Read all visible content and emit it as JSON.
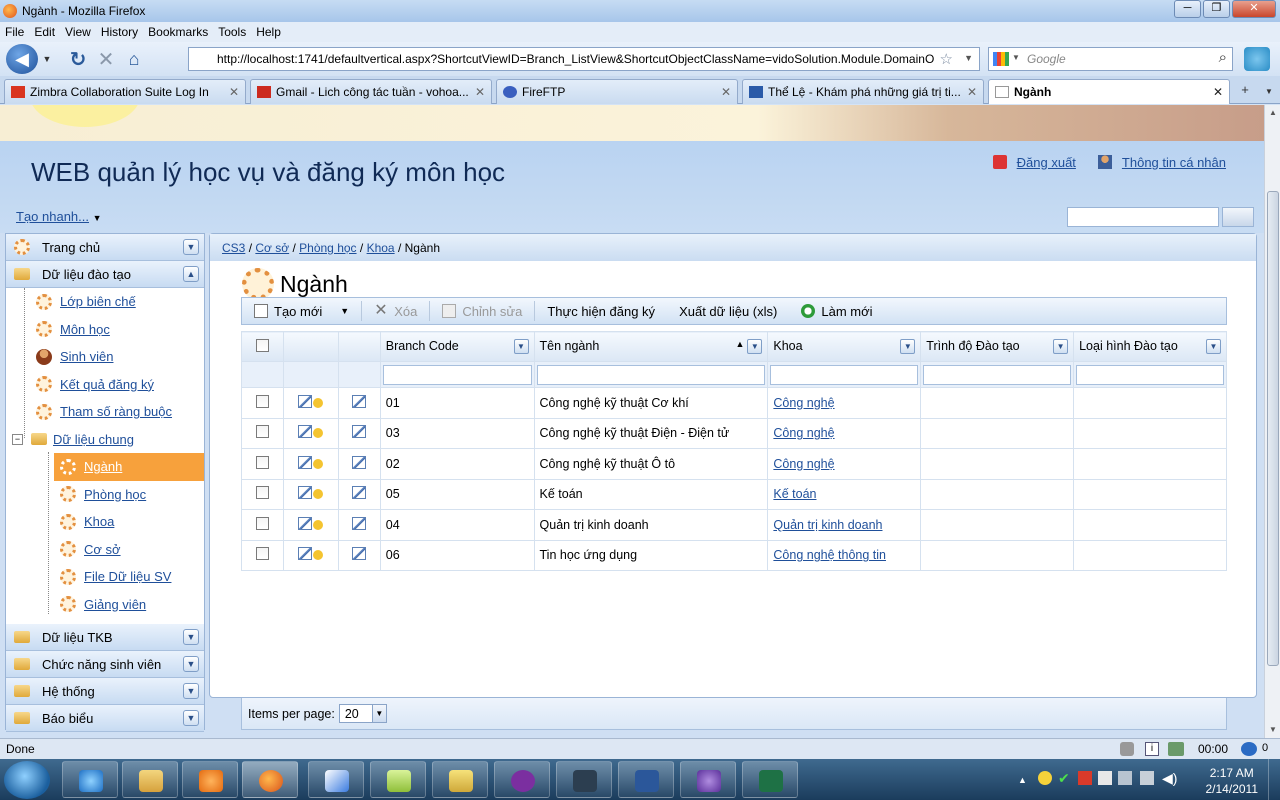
{
  "window": {
    "title": "Ngành - Mozilla Firefox",
    "min": "─",
    "max": "❐",
    "close": "✕"
  },
  "menu": [
    "File",
    "Edit",
    "View",
    "History",
    "Bookmarks",
    "Tools",
    "Help"
  ],
  "nav": {
    "url": "http://localhost:1741/defaultvertical.aspx?ShortcutViewID=Branch_ListView&ShortcutObjectClassName=vidoSolution.Module.DomainO",
    "search_placeholder": "Google"
  },
  "tabs": [
    {
      "label": "Zimbra Collaboration Suite Log In",
      "icon_color": "#d9341f"
    },
    {
      "label": "Gmail - Lich công tác tuần - vohoa...",
      "icon_color": "#cc2a1f"
    },
    {
      "label": "FireFTP",
      "icon_color": "#3a5fbf"
    },
    {
      "label": "Thể Lệ - Khám phá những giá trị ti...",
      "icon_color": "#2a5aa8"
    },
    {
      "label": "Ngành",
      "icon_color": "#ffffff"
    }
  ],
  "header": {
    "app_title": "WEB quản lý học vụ và đăng ký môn học",
    "logout": "Đăng xuất",
    "profile": "Thông tin cá nhân",
    "quick_create": "Tạo nhanh..."
  },
  "sidebar": {
    "home": "Trang chủ",
    "training": "Dữ liệu đào tạo",
    "items": [
      {
        "label": "Lớp biên chế",
        "icon": "gear-icon"
      },
      {
        "label": "Môn học",
        "icon": "gear-icon"
      },
      {
        "label": "Sinh viên",
        "icon": "user-icon"
      },
      {
        "label": "Kết quả đăng ký",
        "icon": "gear-icon"
      },
      {
        "label": "Tham số ràng buộc",
        "icon": "gear-icon"
      }
    ],
    "common": "Dữ liệu chung",
    "common_items": [
      {
        "label": "Ngành",
        "active": true
      },
      {
        "label": "Phòng học"
      },
      {
        "label": "Khoa"
      },
      {
        "label": "Cơ sở"
      },
      {
        "label": "File Dữ liệu SV"
      },
      {
        "label": "Giảng viên"
      }
    ],
    "groups": [
      "Dữ liệu TKB",
      "Chức năng sinh viên",
      "Hệ thống",
      "Báo biểu"
    ]
  },
  "breadcrumb": {
    "items": [
      "CS3",
      "Cơ sở",
      "Phòng học",
      "Khoa"
    ],
    "current": "Ngành",
    "sep": "/"
  },
  "page": {
    "title": "Ngành"
  },
  "toolbar": {
    "new": "Tạo mới",
    "delete": "Xóa",
    "edit": "Chỉnh sửa",
    "register": "Thực hiện đăng ký",
    "export": "Xuất dữ liệu (xls)",
    "refresh": "Làm mới"
  },
  "grid": {
    "columns": [
      "Branch Code",
      "Tên ngành",
      "Khoa",
      "Trình độ Đào tạo",
      "Loại hình Đào tạo"
    ],
    "rows": [
      {
        "code": "01",
        "name": "Công nghệ kỹ thuật Cơ khí",
        "dept": "Công nghệ",
        "level": "",
        "type": ""
      },
      {
        "code": "03",
        "name": "Công nghệ kỹ thuật Điện - Điện tử",
        "dept": "Công nghệ",
        "level": "",
        "type": ""
      },
      {
        "code": "02",
        "name": "Công nghệ kỹ thuật Ô tô",
        "dept": "Công nghệ",
        "level": "",
        "type": ""
      },
      {
        "code": "05",
        "name": "Kế toán",
        "dept": "Kế toán",
        "level": "",
        "type": ""
      },
      {
        "code": "04",
        "name": "Quản trị kinh doanh",
        "dept": "Quản trị kinh doanh",
        "level": "",
        "type": ""
      },
      {
        "code": "06",
        "name": "Tin học ứng dụng",
        "dept": "Công nghệ thông tin",
        "level": "",
        "type": ""
      }
    ],
    "items_per_page_label": "Items per page:",
    "items_per_page": "20"
  },
  "status": {
    "text": "Done",
    "time": "00:00"
  },
  "taskbar": {
    "time": "2:17 AM",
    "date": "2/14/2011"
  }
}
